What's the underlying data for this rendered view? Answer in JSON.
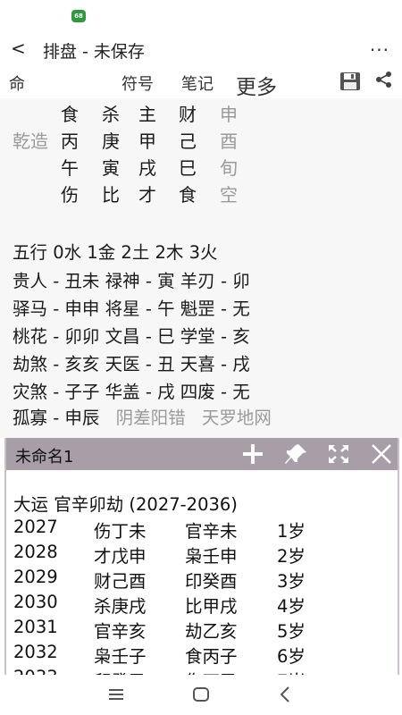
{
  "status": {
    "app_icon_label": "68"
  },
  "app_bar": {
    "back": "<",
    "title": "排盘 - 未保存",
    "more": "..."
  },
  "tabs": [
    "命",
    "符号",
    "笔记",
    "更多"
  ],
  "chart": {
    "gender_label": "乾造",
    "rows": [
      [
        "食",
        "杀",
        "主",
        "财",
        "申"
      ],
      [
        "丙",
        "庚",
        "甲",
        "己",
        "酉"
      ],
      [
        "午",
        "寅",
        "戌",
        "巳",
        "旬"
      ],
      [
        "伤",
        "比",
        "才",
        "食",
        "空"
      ]
    ]
  },
  "wuxing": "五行 0水 1金 2土 2木  3火",
  "shensha": [
    "贵人 - 丑未  禄神 - 寅  羊刃 - 卯",
    "驿马 - 申申  将星 - 午  魁罡 - 无",
    "桃花 - 卯卯  文昌 - 巳  学堂 - 亥",
    "劫煞 - 亥亥  天医 - 丑  天喜 - 戌",
    "灾煞 - 子子  华盖 - 戌  四废 - 无"
  ],
  "guxu": {
    "label": "孤寡 - 申辰",
    "extra1": "阴差阳错",
    "extra2": "天罗地网"
  },
  "panel": {
    "title": "未命名1",
    "dayun_title": "大运  官辛卯劫 (2027-2036)",
    "rows": [
      {
        "year": "2027",
        "a": "伤丁未",
        "b": "官辛未",
        "age": "1岁"
      },
      {
        "year": "2028",
        "a": "才戊申",
        "b": "枭壬申",
        "age": "2岁"
      },
      {
        "year": "2029",
        "a": "财己酉",
        "b": "印癸酉",
        "age": "3岁"
      },
      {
        "year": "2030",
        "a": "杀庚戌",
        "b": "比甲戌",
        "age": "4岁"
      },
      {
        "year": "2031",
        "a": "官辛亥",
        "b": "劫乙亥",
        "age": "5岁"
      },
      {
        "year": "2032",
        "a": "枭壬子",
        "b": "食丙子",
        "age": "6岁"
      },
      {
        "year": "2033",
        "a": "印癸丑",
        "b": "伤丁丑",
        "age": "7岁"
      }
    ]
  },
  "colors": {
    "panel_header": "#a79ea7",
    "gray_text": "#9a9a9a",
    "content_bg": "#f7f7f7"
  }
}
